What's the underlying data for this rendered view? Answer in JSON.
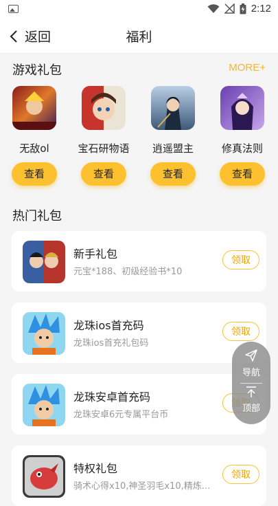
{
  "status_bar": {
    "time": "2:12"
  },
  "header": {
    "back_label": "返回",
    "title": "福利"
  },
  "game_gifts": {
    "section_title": "游戏礼包",
    "more_label": "MORE+",
    "items": [
      {
        "name": "无敌ol",
        "button": "查看"
      },
      {
        "name": "宝石研物语",
        "button": "查看"
      },
      {
        "name": "逍遥盟主",
        "button": "查看"
      },
      {
        "name": "修真法则",
        "button": "查看"
      }
    ]
  },
  "hot_gifts": {
    "section_title": "热门礼包",
    "items": [
      {
        "title": "新手礼包",
        "desc": "元宝*188、初级经验书*10",
        "button": "领取"
      },
      {
        "title": "龙珠ios首充码",
        "desc": "龙珠ios首充礼包码",
        "button": "领取"
      },
      {
        "title": "龙珠安卓首充码",
        "desc": "龙珠安卓6元专属平台币",
        "button": "领取"
      },
      {
        "title": "特权礼包",
        "desc": "骑术心得x10,神圣羽毛x10,精炼...",
        "button": "领取"
      }
    ]
  },
  "float_menu": {
    "nav_label": "导航",
    "top_label": "顶部"
  },
  "colors": {
    "accent": "#fdc130",
    "more": "#f9b52b"
  }
}
